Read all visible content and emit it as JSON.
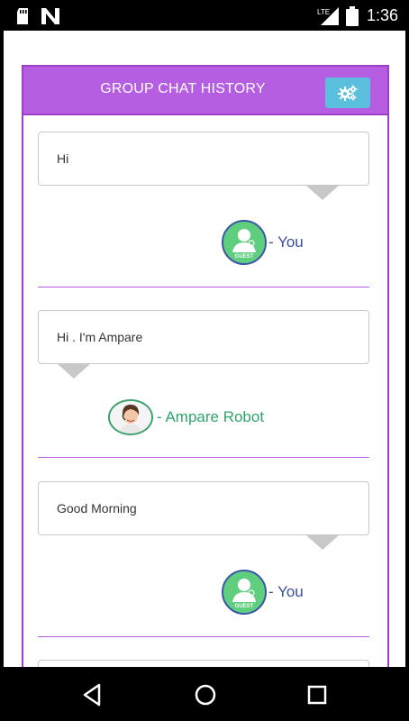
{
  "status_bar": {
    "time": "1:36",
    "network_label": "LTE",
    "icons": [
      "sd-card-icon",
      "n-logo-icon",
      "lte-signal-icon",
      "battery-icon"
    ]
  },
  "header": {
    "title": "GROUP CHAT HISTORY",
    "settings_icon": "gears-icon"
  },
  "messages": [
    {
      "text": "Hi",
      "sender": "- You",
      "side": "right",
      "avatar": "guest",
      "avatar_text": "GUEST"
    },
    {
      "text": "Hi . I'm Ampare",
      "sender": "- Ampare Robot",
      "side": "left",
      "avatar": "robot"
    },
    {
      "text": "Good Morning",
      "sender": "- You",
      "side": "right",
      "avatar": "guest",
      "avatar_text": "GUEST"
    }
  ],
  "colors": {
    "header_bg": "#b55ee2",
    "panel_border": "#9c3fc4",
    "settings_button": "#5bc0de",
    "you_label": "#3a4fa0",
    "robot_label": "#2ea56a",
    "guest_avatar": "#5fce7e"
  },
  "navigation": [
    "back-icon",
    "home-icon",
    "recents-icon"
  ]
}
